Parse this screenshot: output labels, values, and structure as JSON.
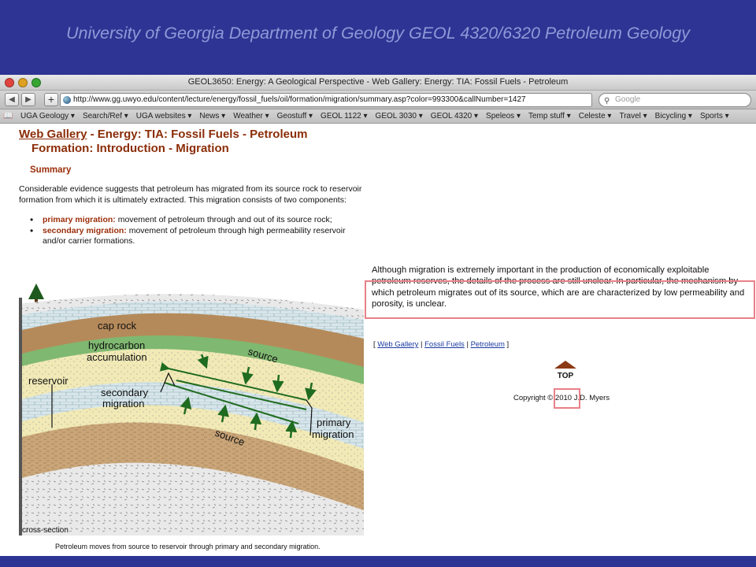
{
  "slide_title": "University of Georgia Department of Geology GEOL 4320/6320 Petroleum Geology",
  "window": {
    "title": "GEOL3650: Energy: A Geological Perspective - Web Gallery: Energy: TIA: Fossil Fuels - Petroleum"
  },
  "toolbar": {
    "back": "◀",
    "forward": "▶",
    "add": "+",
    "url": "http://www.gg.uwyo.edu/content/lecture/energy/fossil_fuels/oil/formation/migration/summary.asp?color=993300&callNumber=1427",
    "search_placeholder": "Google"
  },
  "bookmarks": [
    "UGA Geology ▾",
    "Search/Ref ▾",
    "UGA websites ▾",
    "News ▾",
    "Weather ▾",
    "Geostuff ▾",
    "GEOL 1122 ▾",
    "GEOL 3030 ▾",
    "GEOL 4320 ▾",
    "Speleos ▾",
    "Temp stuff ▾",
    "Celeste ▾",
    "Travel ▾",
    "Bicycling ▾",
    "Sports ▾"
  ],
  "page": {
    "heading_link": "Web Gallery",
    "heading_rest": " - Energy: TIA: Fossil Fuels - Petroleum",
    "heading_line2": "Formation: Introduction - Migration",
    "summary_heading": "Summary",
    "intro": "Considerable evidence suggests that petroleum has migrated from its source rock to reservoir formation from which it is ultimately extracted. This migration consists of two components:",
    "bullets": [
      {
        "term": "primary migration:",
        "text": " movement of petroleum through and out of its source rock;"
      },
      {
        "term": "secondary migration:",
        "text": " movement of petroleum through high permeability reservoir and/or carrier formations."
      }
    ],
    "figure": {
      "labels": {
        "cap_rock": "cap rock",
        "hydrocarbon": "hydrocarbon",
        "accumulation": "accumulation",
        "source_top": "source",
        "reservoir": "reservoir",
        "secondary": "secondary",
        "migration_s": "migration",
        "primary": "primary",
        "migration_p": "migration",
        "source_bottom": "source",
        "cross_section": "cross-section"
      },
      "caption": "Petroleum moves from source to reservoir through primary and secondary migration."
    },
    "right_paragraph": "Although migration is extremely important in the production of economically exploitable petroleum reserves, the details of the process are still unclear. In particular, the mechanism by which petroleum migrates out of its source, which are are characterized by low permeability and porosity, is unclear.",
    "links": {
      "open": "[ ",
      "web_gallery": "Web Gallery",
      "sep1": " | ",
      "fossil_fuels": "Fossil Fuels",
      "sep2": " | ",
      "petroleum": "Petroleum",
      "close": " ]"
    },
    "top_label": "TOP",
    "copyright": "Copyright © 2010 J.D. Myers"
  },
  "colors": {
    "slide_bg": "#2e3493",
    "slide_title": "#8e9ad8",
    "heading": "#8b2d08",
    "highlight_box": "#e88088",
    "link": "#1a3aa0"
  }
}
